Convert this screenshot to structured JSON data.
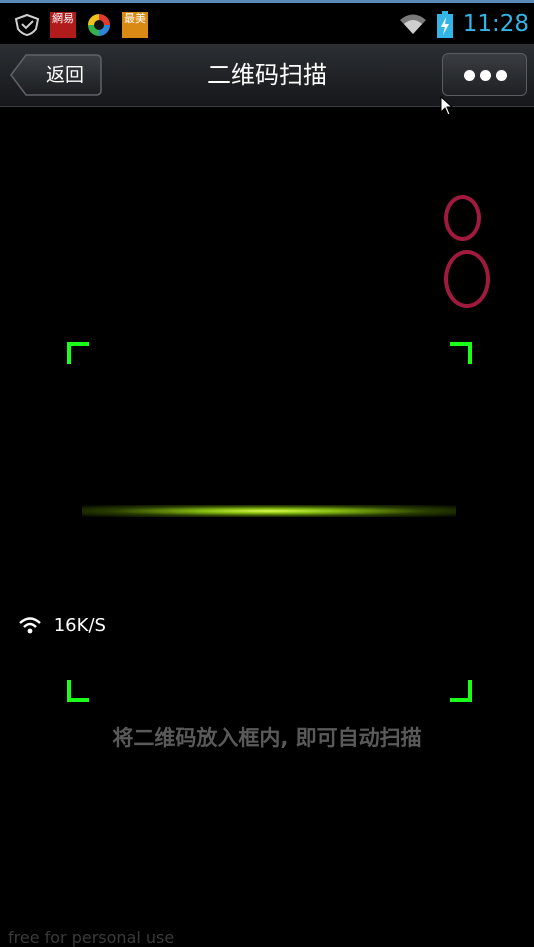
{
  "status_bar": {
    "time": "11:28",
    "app_icons": [
      {
        "name": "shield-icon"
      },
      {
        "name": "netease-app-icon",
        "label": "網易"
      },
      {
        "name": "circle-app-icon"
      },
      {
        "name": "zuimei-app-icon",
        "label": "最美"
      }
    ],
    "colors": {
      "time": "#33b5e5",
      "accent_line": "#5a8ab8"
    }
  },
  "title_bar": {
    "back_label": "返回",
    "title": "二维码扫描",
    "more_icon": "more-dots-icon"
  },
  "scanner": {
    "speed": "16K/S",
    "hint": "将二维码放入框内, 即可自动扫描",
    "colors": {
      "frame": "#1aff1a",
      "scan_line": "#b8f020",
      "rings": "#a01a3e",
      "hint": "#5a5a5a"
    }
  },
  "watermark": "free for personal use"
}
